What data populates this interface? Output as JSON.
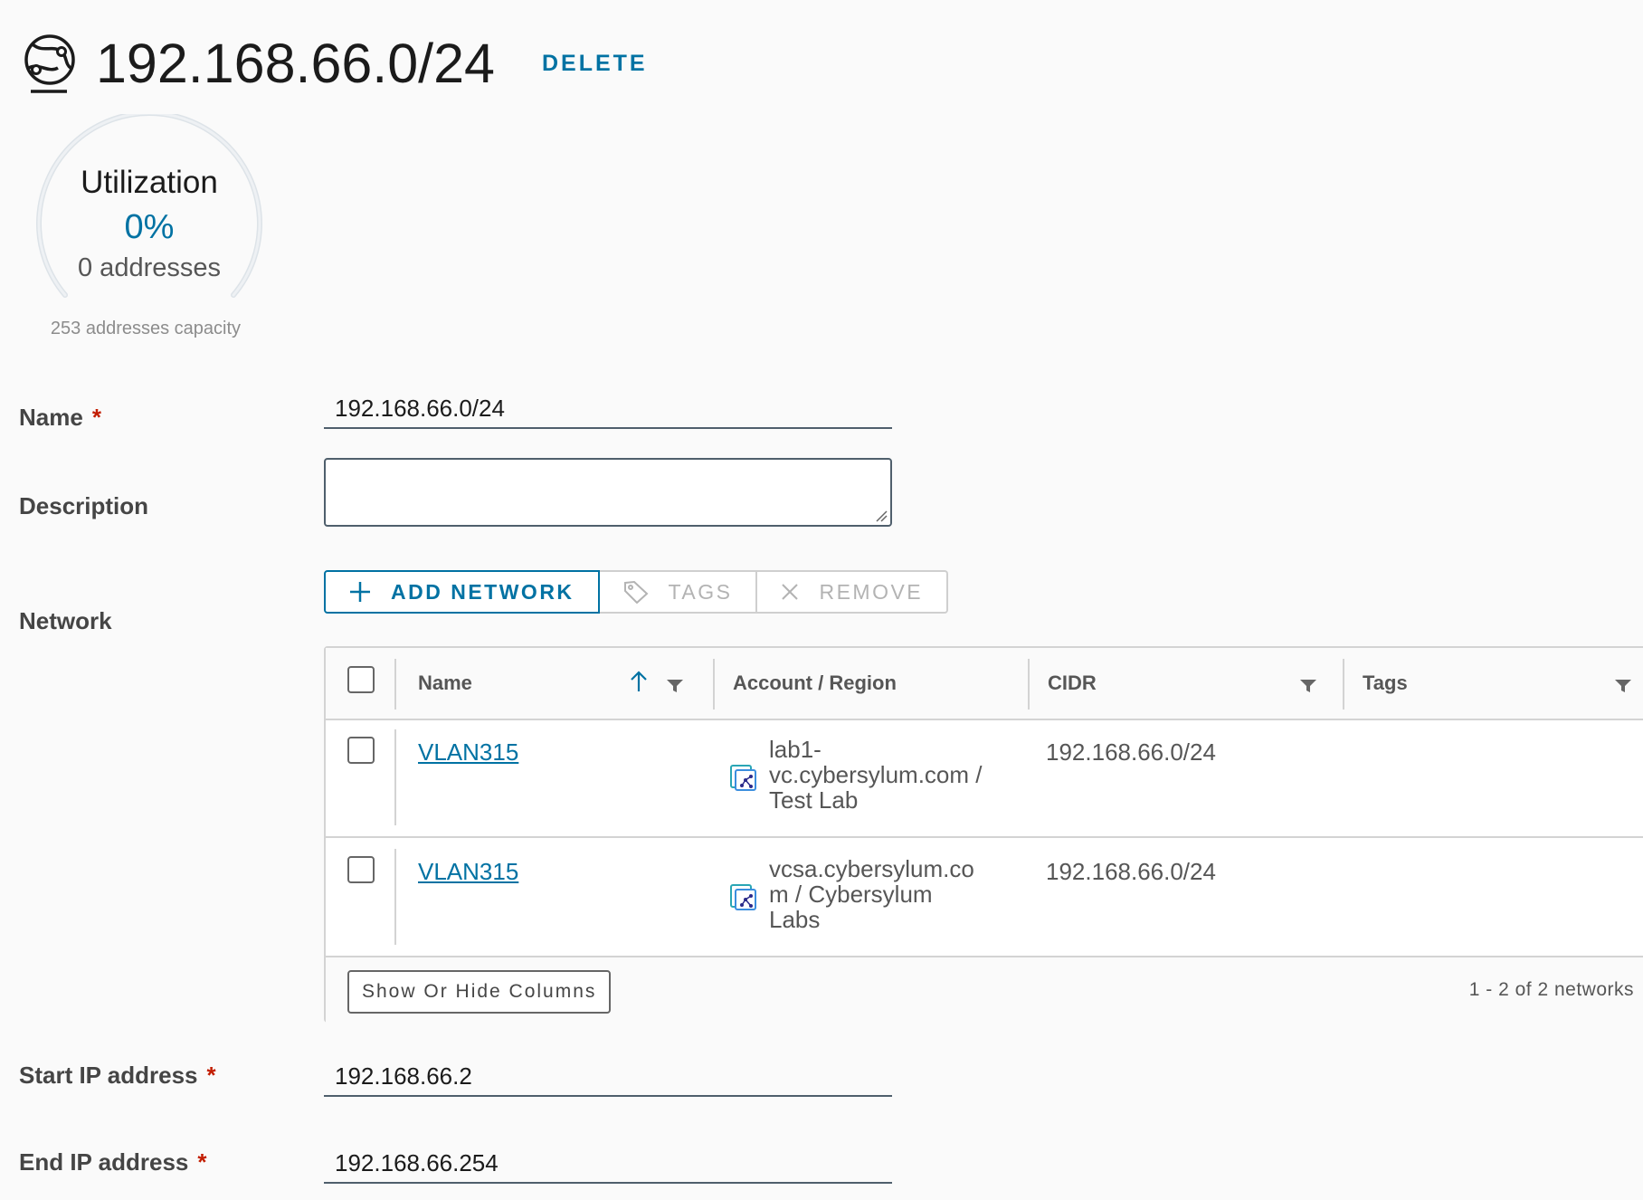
{
  "header": {
    "title": "192.168.66.0/24",
    "delete_label": "DELETE",
    "icon": "network-globe-icon"
  },
  "utilization": {
    "title": "Utilization",
    "percent": "0%",
    "percent_value": 0,
    "addresses": "0 addresses",
    "capacity": "253 addresses capacity"
  },
  "form": {
    "name_label": "Name",
    "name_value": "192.168.66.0/24",
    "description_label": "Description",
    "description_value": "",
    "network_label": "Network",
    "start_ip_label": "Start IP address",
    "start_ip_value": "192.168.66.2",
    "end_ip_label": "End IP address",
    "end_ip_value": "192.168.66.254",
    "required_mark": "*"
  },
  "toolbar": {
    "add_network": "ADD NETWORK",
    "tags": "TAGS",
    "remove": "REMOVE"
  },
  "grid": {
    "columns": {
      "name": "Name",
      "account_region": "Account / Region",
      "cidr": "CIDR",
      "tags": "Tags"
    },
    "rows": [
      {
        "name": "VLAN315",
        "account_region": "lab1-\nvc.cybersylum.com /\nTest Lab",
        "cidr": "192.168.66.0/24",
        "tags": ""
      },
      {
        "name": "VLAN315",
        "account_region": "vcsa.cybersylum.co\nm / Cybersylum\nLabs",
        "cidr": "192.168.66.0/24",
        "tags": ""
      }
    ],
    "show_hide_label": "Show Or Hide Columns",
    "pagination": "1 - 2 of 2 networks"
  },
  "colors": {
    "accent": "#0072a3",
    "required": "#c21d00",
    "background": "#fafafa"
  }
}
